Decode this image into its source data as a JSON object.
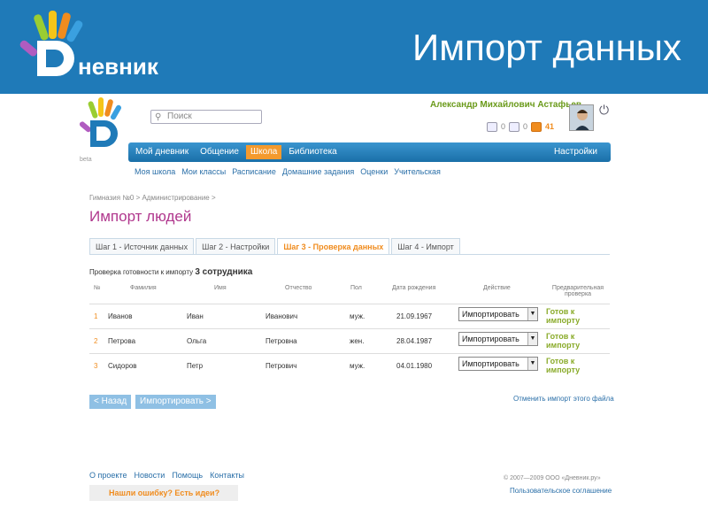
{
  "slide": {
    "title": "Импорт данных",
    "logo_text": "невник",
    "header_color": "#1f7ab8"
  },
  "app": {
    "logo_beta": "beta",
    "search_placeholder": "Поиск",
    "user_name": "Александр Михайлович Астафьев",
    "counters": [
      "0",
      "0",
      "41"
    ],
    "nav": [
      {
        "label": "Мой дневник"
      },
      {
        "label": "Общение"
      },
      {
        "label": "Школа",
        "active": true
      },
      {
        "label": "Библиотека"
      }
    ],
    "nav_settings": "Настройки",
    "subnav": [
      "Моя школа",
      "Мои классы",
      "Расписание",
      "Домашние задания",
      "Оценки",
      "Учительская"
    ],
    "breadcrumb": "Гимназия №0 > Администрирование >",
    "page_title": "Импорт людей",
    "tabs": [
      "Шаг 1 - Источник данных",
      "Шаг 2 - Настройки",
      "Шаг 3 - Проверка данных",
      "Шаг 4 - Импорт"
    ],
    "active_tab": 2,
    "check_prefix": "Проверка готовности к импорту",
    "check_count": "3 сотрудника",
    "columns": [
      "№",
      "Фамилия",
      "Имя",
      "Отчество",
      "Пол",
      "Дата рождения",
      "Действие",
      "Предварительная проверка"
    ],
    "rows": [
      {
        "num": "1",
        "last": "Иванов",
        "first": "Иван",
        "middle": "Иванович",
        "gender": "муж.",
        "dob": "21.09.1967",
        "action": "Импортировать",
        "status": "Готов к импорту"
      },
      {
        "num": "2",
        "last": "Петрова",
        "first": "Ольга",
        "middle": "Петровна",
        "gender": "жен.",
        "dob": "28.04.1987",
        "action": "Импортировать",
        "status": "Готов к импорту"
      },
      {
        "num": "3",
        "last": "Сидоров",
        "first": "Петр",
        "middle": "Петрович",
        "gender": "муж.",
        "dob": "04.01.1980",
        "action": "Импортировать",
        "status": "Готов к импорту"
      }
    ],
    "back_label": "< Назад",
    "import_label": "Импортировать >",
    "cancel_label": "Отменить импорт этого файла",
    "footer_links": [
      "О проекте",
      "Новости",
      "Помощь",
      "Контакты"
    ],
    "copyright": "© 2007—2009 ООО «Дневник.ру»",
    "agreement": "Пользовательское соглашение",
    "feedback": "Нашли ошибку? Есть идеи?"
  }
}
